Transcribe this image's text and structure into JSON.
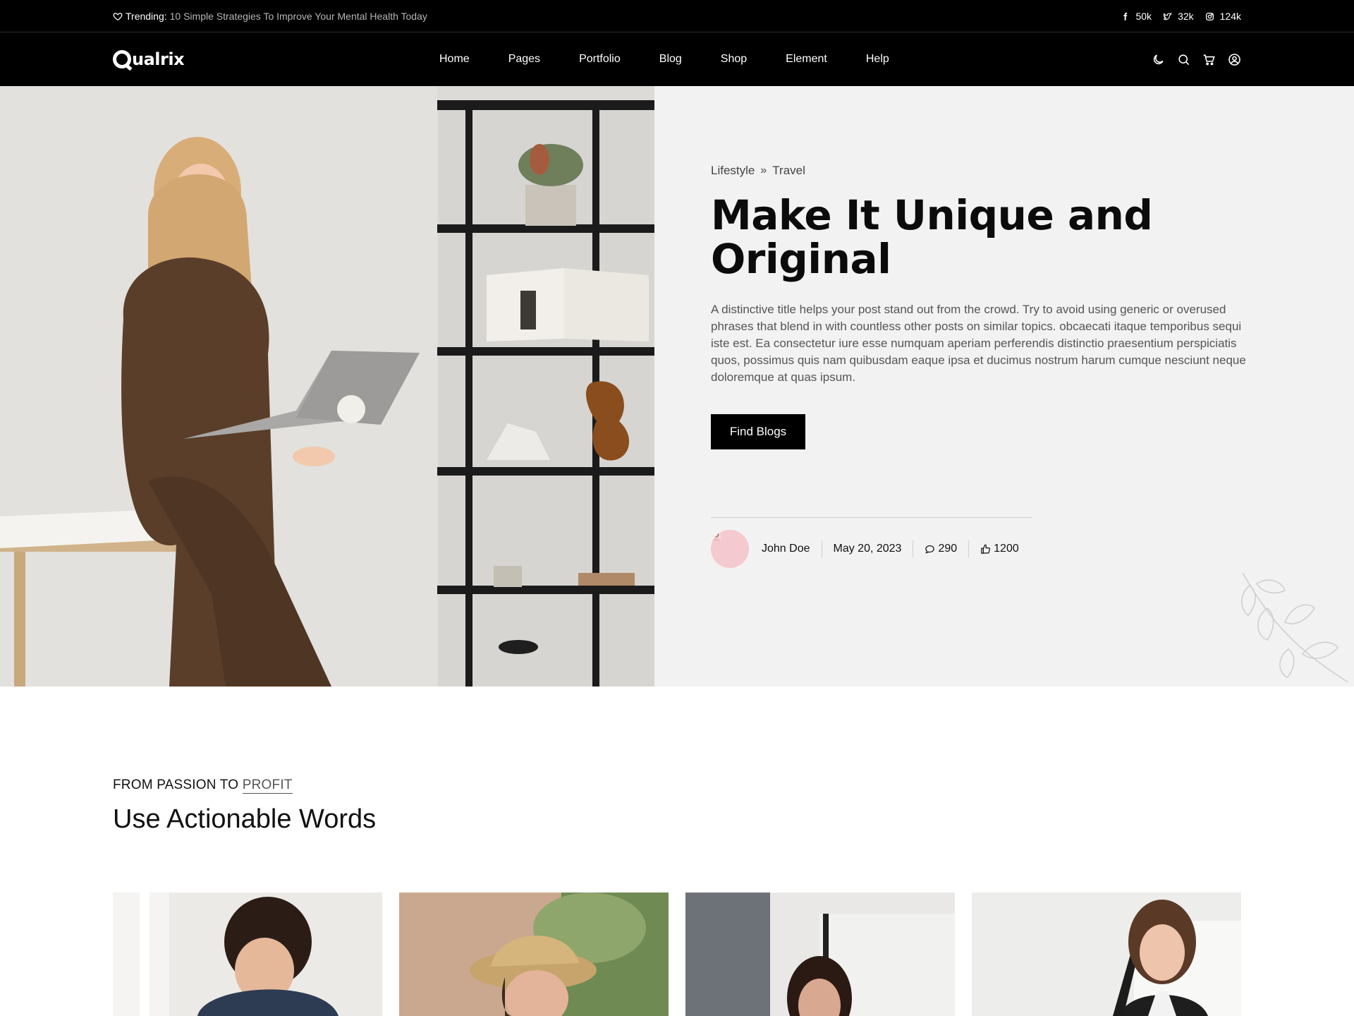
{
  "topbar": {
    "trending_label": "Trending:",
    "trending_text": "10 Simple Strategies To Improve Your Mental Health Today",
    "socials": [
      {
        "icon": "facebook-icon",
        "count": "50k"
      },
      {
        "icon": "twitter-icon",
        "count": "32k"
      },
      {
        "icon": "instagram-icon",
        "count": "124k"
      }
    ]
  },
  "nav": {
    "logo": "ualrix",
    "items": [
      "Home",
      "Pages",
      "Portfolio",
      "Blog",
      "Shop",
      "Element",
      "Help"
    ],
    "icons": [
      "moon-icon",
      "search-icon",
      "cart-icon",
      "user-icon"
    ]
  },
  "hero": {
    "breadcrumb": [
      "Lifestyle",
      "Travel"
    ],
    "breadcrumb_separator": "»",
    "title": "Make It Unique and Original",
    "description": "A distinctive title helps your post stand out from the crowd. Try to avoid using generic or overused phrases that blend in with countless other posts on similar topics. obcaecati itaque temporibus sequi iste est. Ea consectetur iure esse numquam aperiam perferendis distinctio praesentium perspiciatis quos, possimus quis nam quibusdam eaque ipsa et ducimus nostrum harum cumque nesciunt neque doloremque at quas ipsum.",
    "cta": "Find Blogs",
    "meta": {
      "author": "John Doe",
      "date": "May 20, 2023",
      "comments": "290",
      "likes": "1200"
    }
  },
  "section": {
    "kicker_prefix": "FROM PASSION TO",
    "kicker_accent": "PROFIT",
    "title": "Use Actionable Words"
  },
  "colors": {
    "bar_background": "#000000",
    "hero_background": "#f2f2f2",
    "text_dark": "#111111",
    "text_muted": "#555555"
  }
}
